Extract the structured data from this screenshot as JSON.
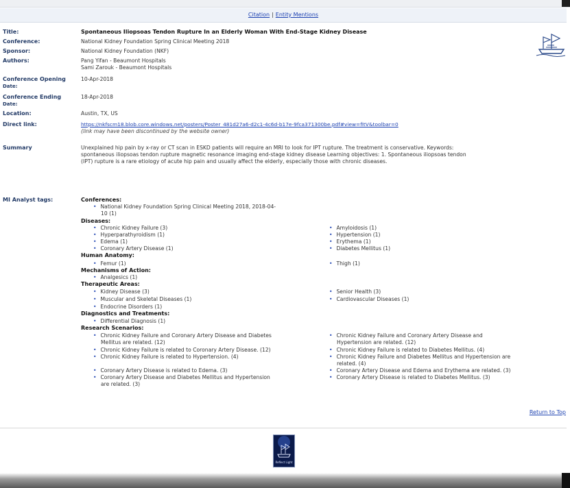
{
  "header": {
    "citation_label": "Citation",
    "separator": "|",
    "entity_mentions_label": "Entity Mentions"
  },
  "record": {
    "title_label": "Title:",
    "title": "Spontaneous Iliopsoas Tendon Rupture In an Elderly Woman With End-Stage Kidney Disease",
    "conference_label": "Conference:",
    "conference": "National Kidney Foundation Spring Clinical Meeting 2018",
    "sponsor_label": "Sponsor:",
    "sponsor": "National Kidney Foundation (NKF)",
    "authors_label": "Authors:",
    "authors": [
      "Pang Yifan - Beaumont Hospitals",
      "Sami Zarouk - Beaumont Hospitals"
    ],
    "opening_label_1": "Conference Opening",
    "opening_label_2": "Date:",
    "opening": "10-Apr-2018",
    "ending_label_1": "Conference Ending",
    "ending_label_2": "Date:",
    "ending": "18-Apr-2018",
    "location_label": "Location:",
    "location": "Austin, TX, US",
    "direct_link_label": "Direct link:",
    "direct_link": "https://nkfscm18.blob.core.windows.net/posters/Poster_481d27a6-d2c1-4c6d-b17e-9fca371300be.pdf#view=fitV&toolbar=0",
    "direct_link_note": "(link may have been discontinued by the website owner)",
    "summary_label": "Summary",
    "summary_lines": [
      "Unexplained hip pain by x-ray or CT scan in ESKD patients will require an MRI to look for IPT rupture. The treatment is conservative. Keywords:",
      "spontaneous iliopsoas tendon rupture magnetic resonance imaging end-stage kidney disease Learning objectives: 1. Spontaneous iliopsoas tendon",
      "(IPT) rupture is a rare etiology of acute hip pain and usually affect the elderly, especially those with chronic diseases."
    ],
    "tags_label": "MI Analyst tags:"
  },
  "tags": {
    "conferences_heading": "Conferences:",
    "conf_item_1": "National Kidney Foundation Spring Clinical Meeting 2018, 2018-04-",
    "conf_item_2": "10 (1)",
    "diseases_heading": "Diseases:",
    "diseases_left": [
      "Chronic Kidney Failure (3)",
      "Hyperparathyroidism (1)",
      "Edema (1)",
      "Coronary Artery Disease (1)"
    ],
    "diseases_right": [
      "Amyloidosis (1)",
      "Hypertension (1)",
      "Erythema (1)",
      "Diabetes Mellitus (1)"
    ],
    "anatomy_heading": "Human Anatomy:",
    "anatomy_left": "Femur (1)",
    "anatomy_right": "Thigh (1)",
    "moa_heading": "Mechanisms of Action:",
    "moa_left": "Analgesics (1)",
    "ta_heading": "Therapeutic Areas:",
    "ta_left": [
      "Kidney Disease (3)",
      "Muscular and Skeletal Diseases (1)",
      "Endocrine Disorders (1)"
    ],
    "ta_right": [
      "Senior Health (3)",
      "Cardiovascular Diseases (1)"
    ],
    "dx_heading": "Diagnostics and Treatments:",
    "dx_left": "Differential Diagnosis (1)",
    "rs_heading": "Research Scenarios:",
    "rs_left": [
      [
        "Chronic Kidney Failure and Coronary Artery Disease and Diabetes",
        "Mellitus are related. (12)"
      ],
      [
        "Chronic Kidney Failure is related to Coronary Artery Disease. (12)"
      ],
      [
        "Chronic Kidney Failure is related to Hypertension. (4)"
      ],
      [
        "Coronary Artery Disease is related to Edema. (3)"
      ],
      [
        "Coronary Artery Disease and Diabetes Mellitus and Hypertension",
        "are related. (3)"
      ]
    ],
    "rs_right": [
      [
        "Chronic Kidney Failure and Coronary Artery Disease and",
        "Hypertension are related. (12)"
      ],
      [
        "Chronic Kidney Failure is related to Diabetes Mellitus. (4)"
      ],
      [
        "Chronic Kidney Failure and Diabetes Mellitus and Hypertension are",
        "related. (4)"
      ],
      [
        "Coronary Artery Disease and Edema and Erythema are related. (3)"
      ],
      [
        "Coronary Artery Disease is related to Diabetes Mellitus. (3)"
      ]
    ]
  },
  "footer": {
    "return_to_top": "Return to Top",
    "logo_caption": "Reflect Light"
  },
  "colors": {
    "link": "#1a3fb0",
    "label": "#223a66",
    "bar": "#eef2f8"
  },
  "icons": {
    "top_logo": "ship-logo-icon",
    "footer_logo": "ship-badge-icon"
  }
}
